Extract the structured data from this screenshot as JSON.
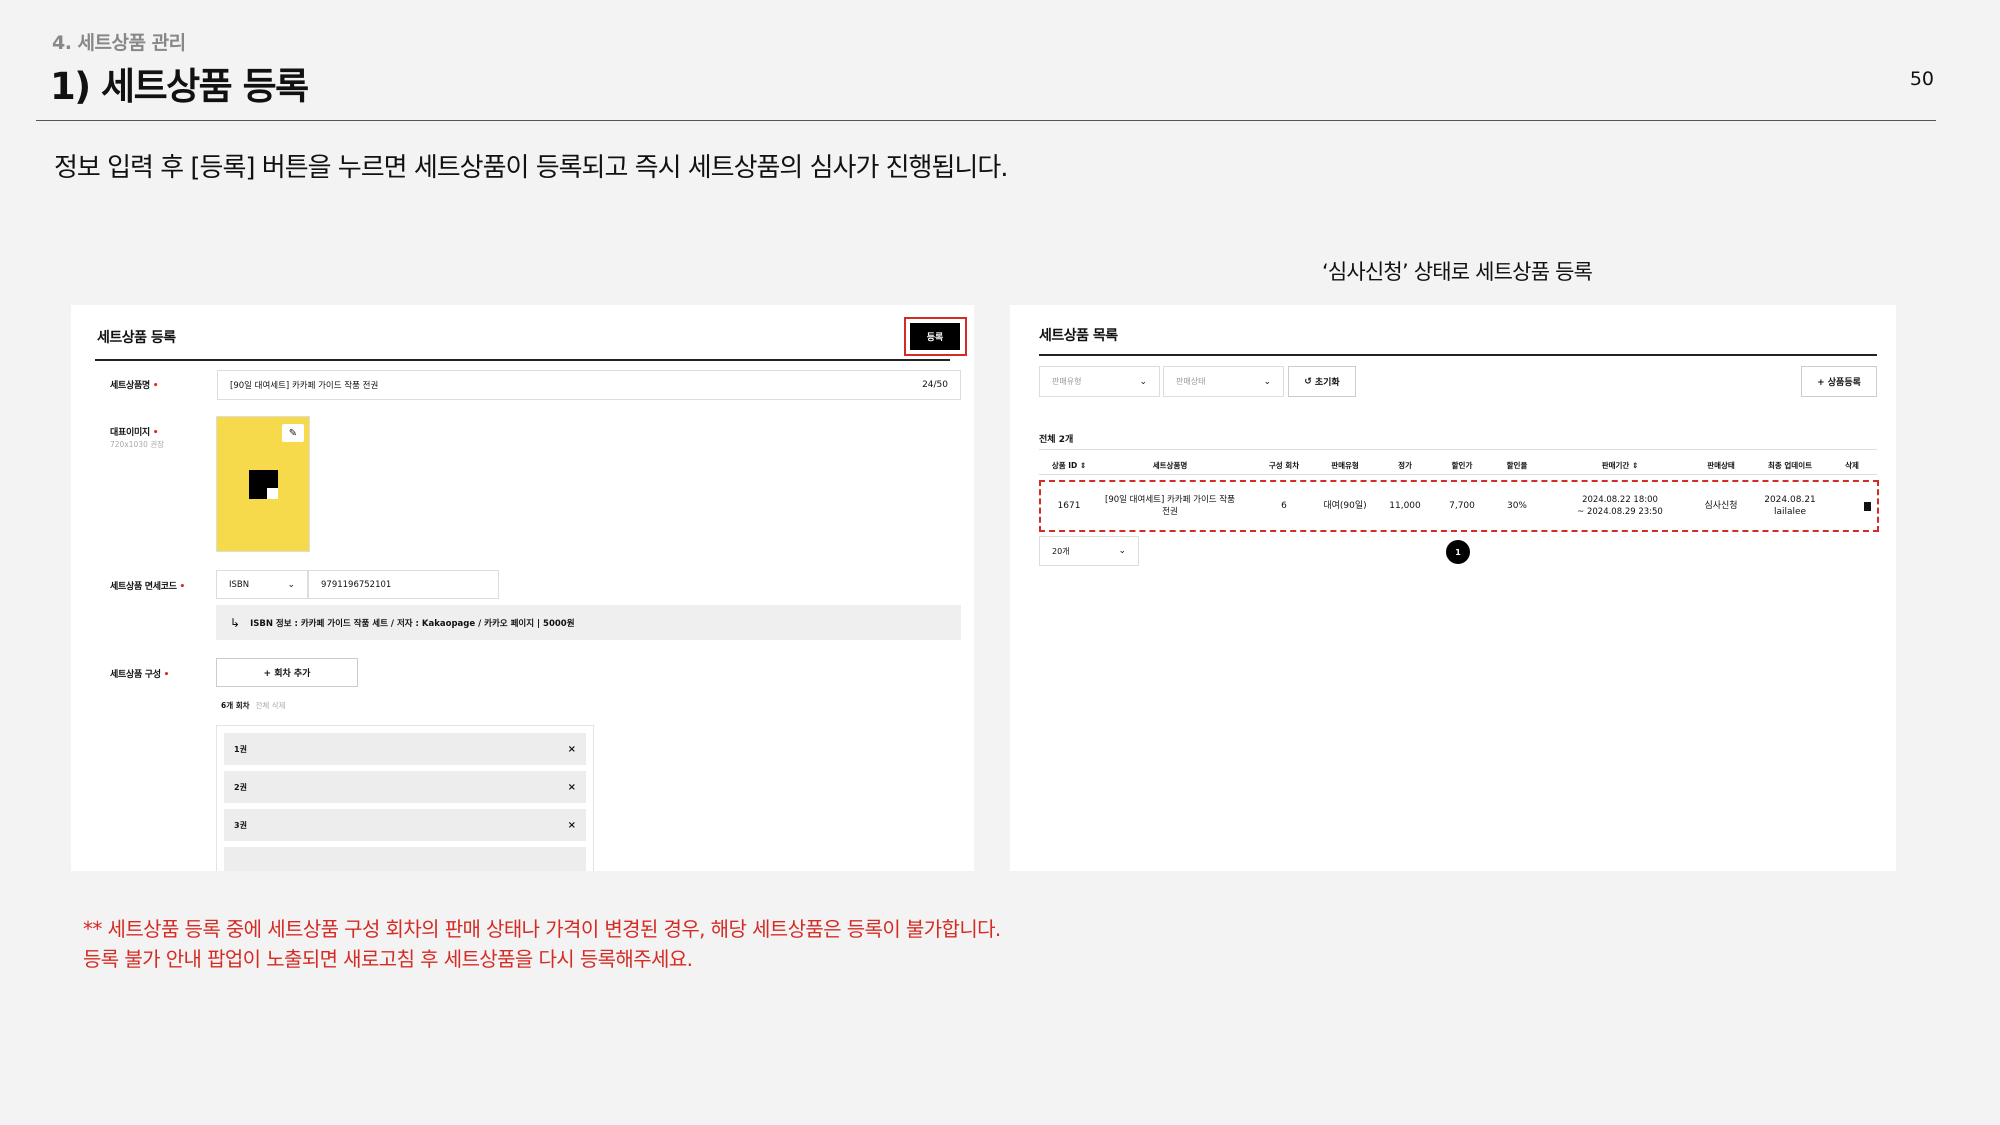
{
  "header": {
    "section": "4. 세트상품 관리",
    "title": "1) 세트상품 등록",
    "page_number": "50"
  },
  "lead": "정보 입력 후 [등록] 버튼을 누르면 세트상품이 등록되고 즉시 세트상품의 심사가 진행됩니다.",
  "right_caption": "‘심사신청’ 상태로 세트상품 등록",
  "left_panel": {
    "title": "세트상품 등록",
    "register_button": "등록",
    "name_label": "세트상품명",
    "name_value": "[90일 대여세트] 카카페 가이드 작품 전권",
    "name_counter": "24/50",
    "image_label": "대표이미지",
    "image_hint": "720x1030 권장",
    "code_label": "세트상품 면세코드",
    "code_type": "ISBN",
    "code_value": "9791196752101",
    "isbn_info": "ISBN 정보 : 카카페 가이드 작품 세트 / 저자 : Kakaopage / 카카오 페이지 | 5000원",
    "composition_label": "세트상품 구성",
    "add_episode_button": "+ 회차 추가",
    "episode_count": "6개 회차",
    "delete_all": "전체 삭제",
    "episodes": [
      "1권",
      "2권",
      "3권"
    ]
  },
  "right_panel": {
    "title": "세트상품 목록",
    "filter_sale_type": "판매유형",
    "filter_sale_status": "판매상태",
    "reset_button": "초기화",
    "add_product_button": "+ 상품등록",
    "total": "전체 2개",
    "columns": [
      "상품 ID",
      "세트상품명",
      "구성 회차",
      "판매유형",
      "정가",
      "할인가",
      "할인율",
      "판매기간",
      "판매상태",
      "최종 업데이트",
      "삭제"
    ],
    "row": {
      "id": "1671",
      "name_line1": "[90일 대여세트] 카카페 가이드 작품",
      "name_line2": "전권",
      "episodes": "6",
      "sale_type": "대여(90일)",
      "price": "11,000",
      "discount_price": "7,700",
      "discount_rate": "30%",
      "period_line1": "2024.08.22 18:00",
      "period_line2": "~ 2024.08.29 23:50",
      "status": "심사신청",
      "updated_line1": "2024.08.21",
      "updated_line2": "lailalee"
    },
    "page_size": "20개",
    "current_page": "1"
  },
  "notice": {
    "line1": "** 세트상품 등록 중에 세트상품 구성 회차의 판매 상태나 가격이 변경된 경우, 해당 세트상품은 등록이 불가합니다.",
    "line2": "등록 불가 안내 팝업이 노출되면 새로고침 후 세트상품을 다시 등록해주세요."
  },
  "colors": {
    "accent_red": "#d42c25",
    "thumbnail_yellow": "#f7d94c",
    "background": "#f3f3f3"
  }
}
